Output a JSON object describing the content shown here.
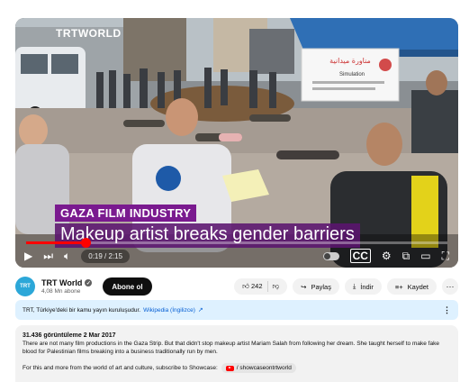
{
  "video": {
    "logo_text": "TRTWORLD",
    "kicker": "GAZA FILM INDUSTRY",
    "headline": "Makeup artist breaks gender barriers",
    "sign_title": "مناورة ميدانية",
    "sign_subtitle": "Simulation",
    "time": "0:19 / 2:15",
    "progress_fraction": 0.14,
    "accent_color": "#ff0000",
    "title_card_color": "#7a1a8f",
    "controls_icons": [
      "play-icon",
      "next-icon",
      "volume-icon",
      "autoplay-toggle",
      "subtitles-icon",
      "settings-icon",
      "miniplayer-icon",
      "theater-icon",
      "fullscreen-icon"
    ]
  },
  "channel": {
    "name": "TRT World",
    "avatar_text": "TRT",
    "subscribers": "4,08 Mn abone",
    "subscribe_label": "Abone ol"
  },
  "actions": {
    "likes": "242",
    "share_label": "Paylaş",
    "download_label": "İndir",
    "save_label": "Kaydet",
    "more_label": "···"
  },
  "banner": {
    "text": "TRT, Türkiye'deki bir kamu yayın kuruluşudur.",
    "link": "Wikipedia (İngilizce)"
  },
  "description": {
    "meta": "31.436 görüntüleme  2 Mar 2017",
    "text": "There are not many film productions in the Gaza Strip. But that didn't stop makeup artist Mariam Salah from following her dream. She taught herself to make fake blood for Palestinian films breaking into a business traditionally run by men.",
    "cta_text": "For this and more from the world of art and culture, subscribe to Showcase:",
    "cta_chip": "/ showcaseontrtworld"
  }
}
